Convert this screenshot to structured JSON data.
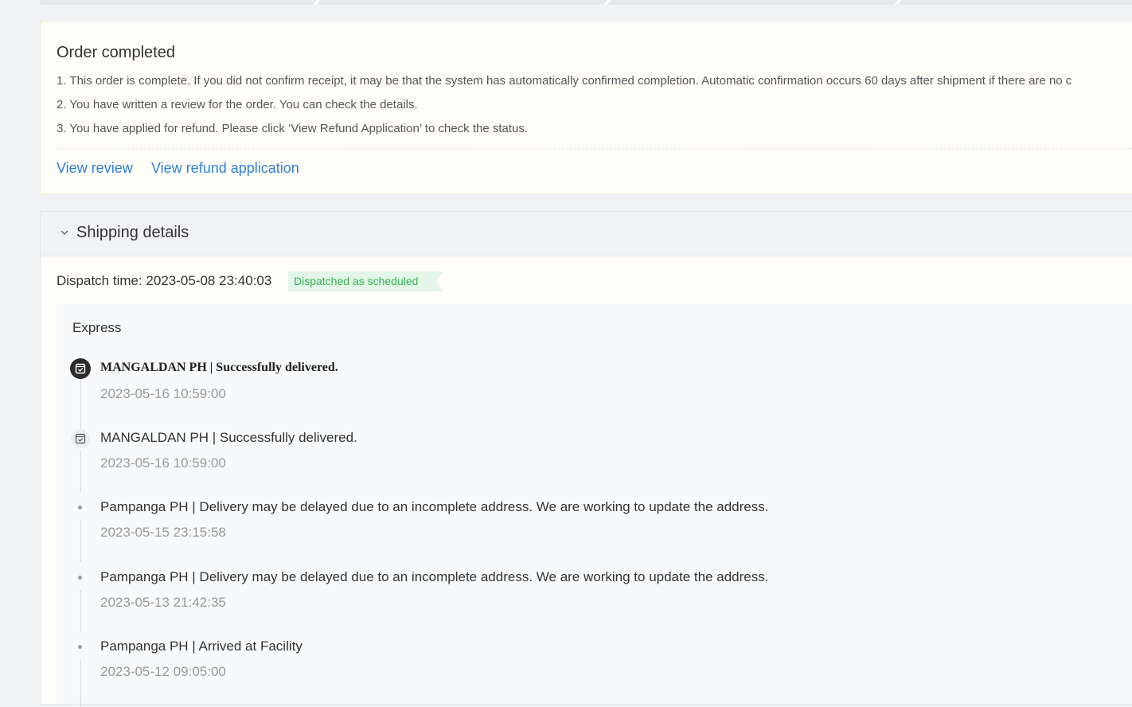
{
  "status": {
    "title": "Order completed",
    "notes": [
      "1. This order is complete. If you did not confirm receipt, it may be that the system has automatically confirmed completion. Automatic confirmation occurs 60 days after shipment if there are no c",
      "2. You have written a review for the order. You can check the details.",
      "3. You have applied for refund. Please click ‘View Refund Application’ to check the status."
    ],
    "actions": {
      "view_review": "View review",
      "view_refund": "View refund application"
    }
  },
  "shipping": {
    "title": "Shipping details",
    "dispatch_label": "Dispatch time: 2023-05-08 23:40:03",
    "dispatch_badge": "Dispatched as scheduled",
    "carrier": "Express",
    "events": [
      {
        "text": "MANGALDAN PH | Successfully delivered.",
        "time": "2023-05-16 10:59:00",
        "icon": "delivered-box-icon"
      },
      {
        "text": "MANGALDAN PH | Successfully delivered.",
        "time": "2023-05-16 10:59:00",
        "icon": "delivered-box-icon"
      },
      {
        "text": "Pampanga PH | Delivery may be delayed due to an incomplete address. We are working to update the address.",
        "time": "2023-05-15 23:15:58",
        "icon": "dot-icon"
      },
      {
        "text": "Pampanga PH | Delivery may be delayed due to an incomplete address. We are working to update the address.",
        "time": "2023-05-13 21:42:35",
        "icon": "dot-icon"
      },
      {
        "text": "Pampanga PH | Arrived at Facility",
        "time": "2023-05-12 09:05:00",
        "icon": "dot-icon"
      }
    ]
  },
  "colors": {
    "link": "#2f7fd6",
    "badge_text": "#36b257",
    "badge_bg": "#e3f6e7"
  }
}
